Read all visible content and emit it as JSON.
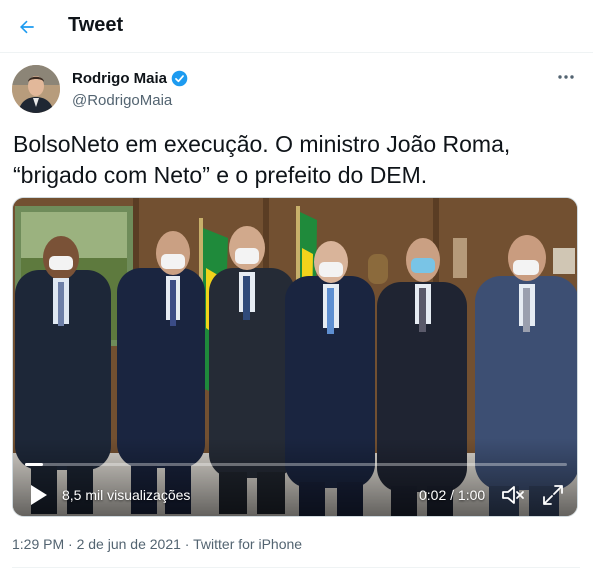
{
  "header": {
    "title": "Tweet"
  },
  "author": {
    "name": "Rodrigo Maia",
    "handle": "@RodrigoMaia",
    "verified": true
  },
  "tweet": {
    "text": "BolsoNeto em execução. O ministro João Roma, “brigado com Neto” e o prefeito do DEM."
  },
  "video": {
    "views": "8,5 mil visualizações",
    "time": "0:02 / 1:00",
    "progress": 0.033
  },
  "meta": {
    "time": "1:29 PM",
    "sep1": " · ",
    "date": "2 de jun de 2021",
    "sep2": " · ",
    "source": "Twitter for iPhone"
  },
  "icons": {
    "back": "arrow-left-icon",
    "verified": "verified-badge-icon",
    "more": "more-dots-icon",
    "play": "play-icon",
    "mute": "volume-muted-icon",
    "fullscreen": "fullscreen-icon"
  },
  "colors": {
    "accent": "#1d9bf0",
    "text": "#0f1419",
    "secondary": "#536471"
  }
}
